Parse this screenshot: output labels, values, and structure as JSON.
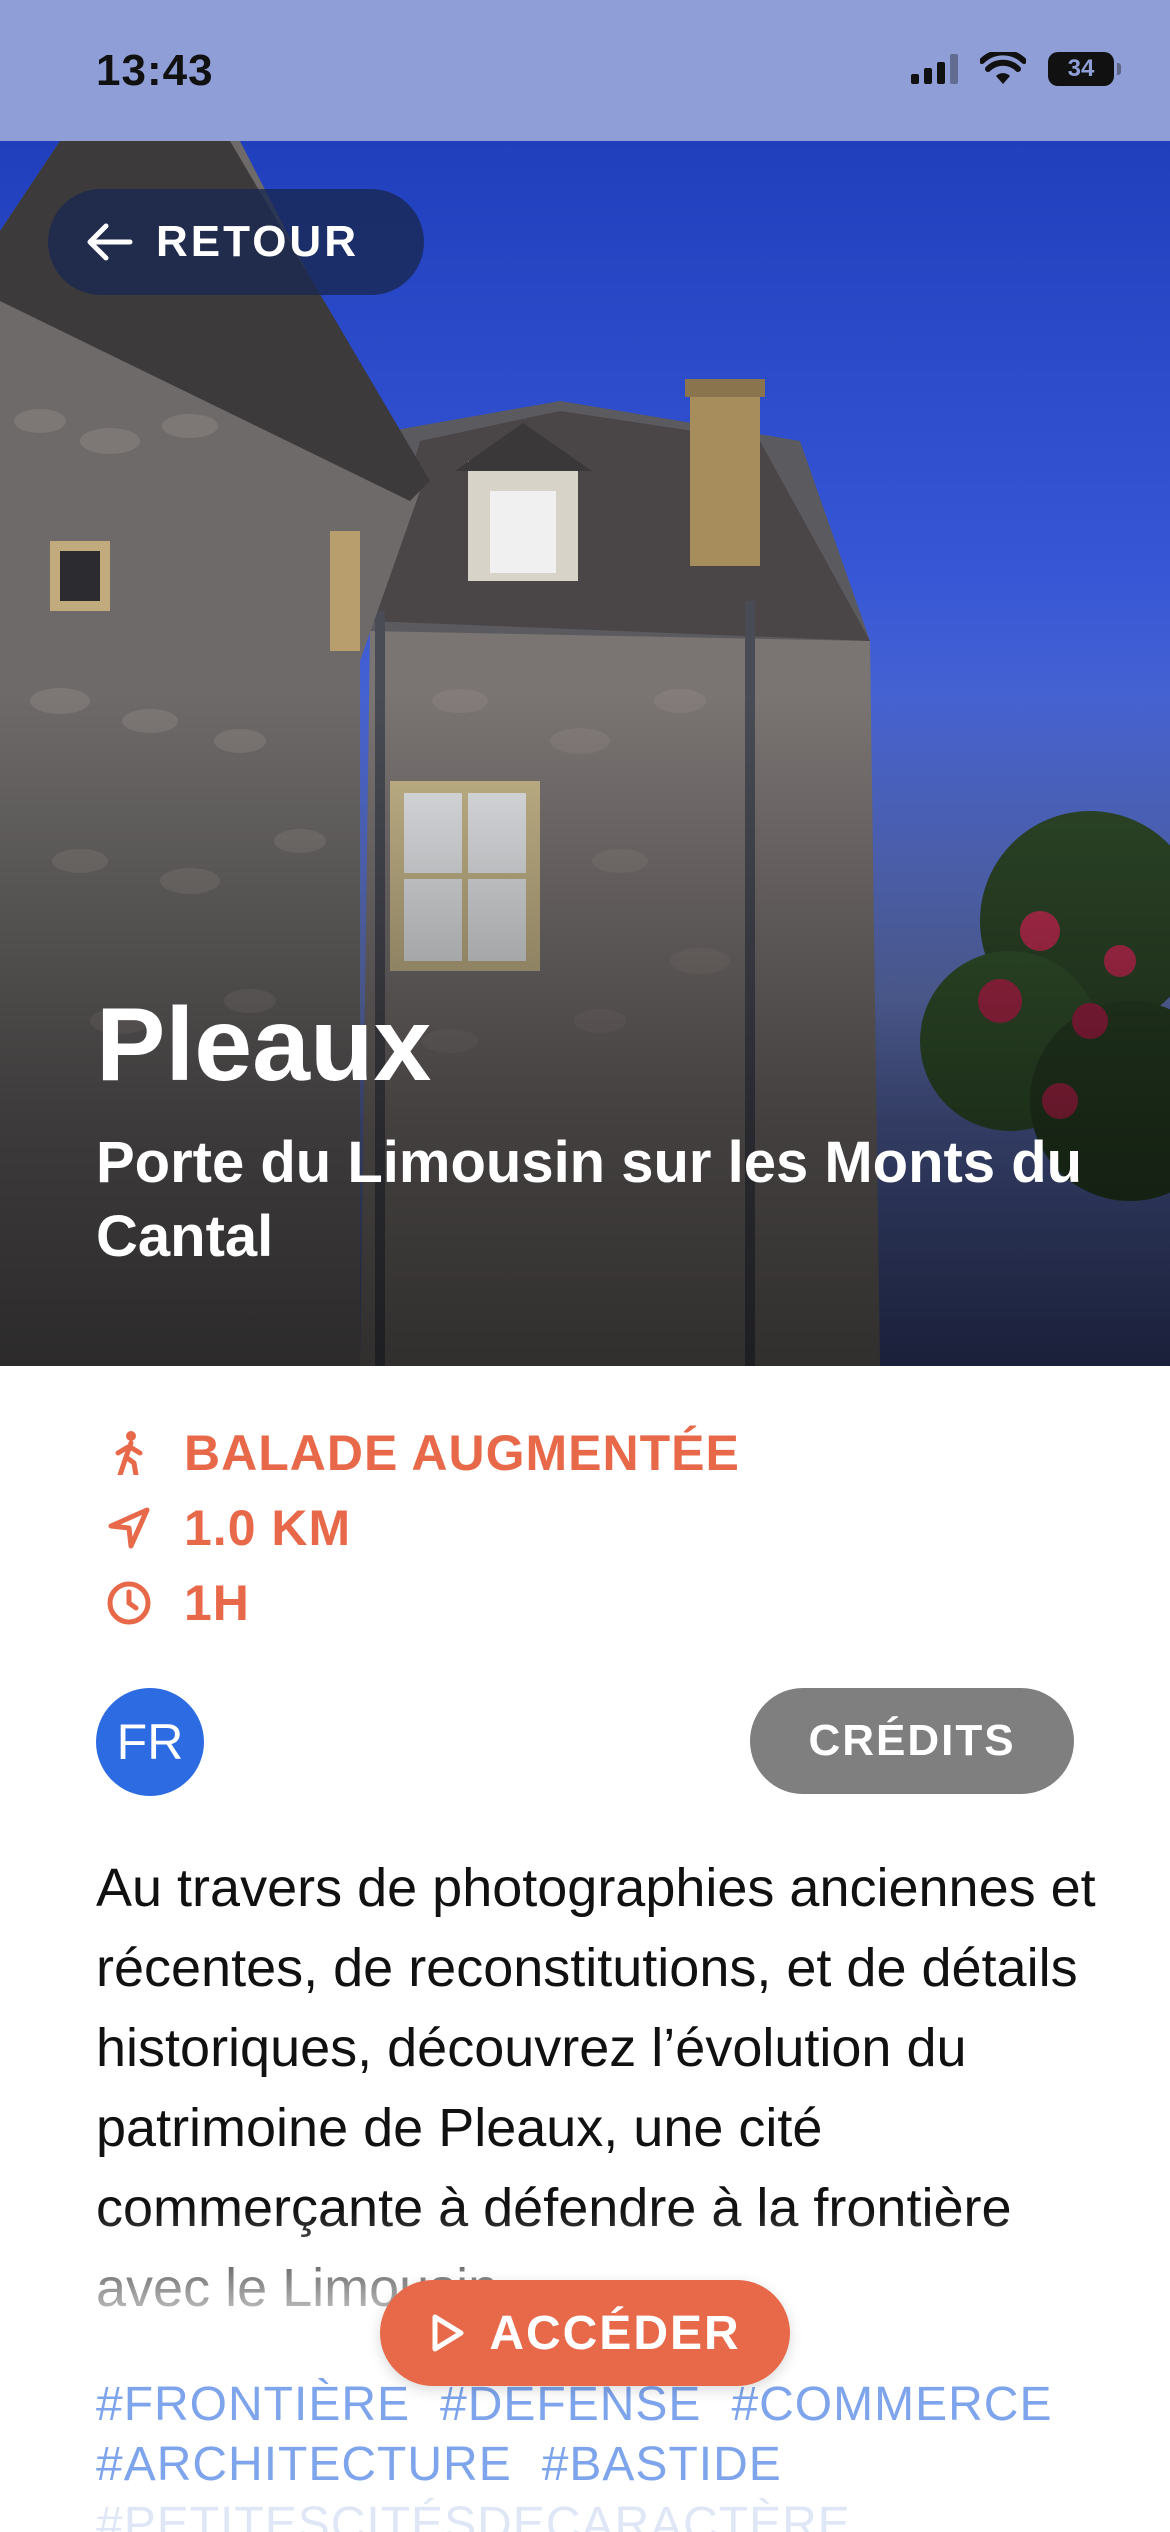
{
  "status_bar": {
    "time": "13:43",
    "battery": "34"
  },
  "hero": {
    "back_label": "RETOUR",
    "title": "Pleaux",
    "subtitle": "Porte du Limousin sur les Monts du Cantal"
  },
  "info": [
    {
      "icon": "walker-icon",
      "text": "BALADE AUGMENTÉE"
    },
    {
      "icon": "navigation-arrow-icon",
      "text": "1.0 KM"
    },
    {
      "icon": "clock-icon",
      "text": "1H"
    }
  ],
  "language": "FR",
  "credits_label": "CRÉDITS",
  "description": "Au travers de photographies anciennes et récentes, de reconstitutions, et de détails historiques, découvrez l’évolution du patrimoine de Pleaux, une cité commerçante à défendre à la frontière avec le Limousin.",
  "access_label": "ACCÉDER",
  "tags": [
    "#FRONTIÈRE",
    "#DEFENSE",
    "#COMMERCE",
    "#ARCHITECTURE",
    "#BASTIDE",
    "#PETITESCITÉSDECARACTÈRE"
  ],
  "colors": {
    "accent": "#e8694a",
    "language_badge": "#2c6be2",
    "credits": "#7f7f7f",
    "tag": "#7ea4ec"
  }
}
